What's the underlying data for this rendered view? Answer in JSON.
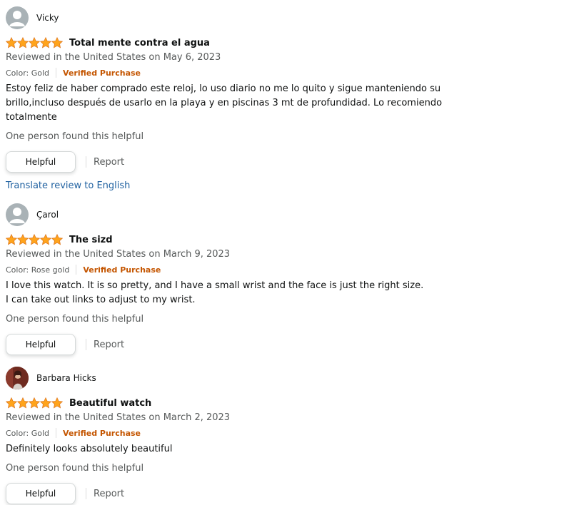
{
  "reviews": [
    {
      "profile_name": "Vicky",
      "avatar": "default-avatar-icon",
      "rating": 5,
      "title": "Total mente contra el agua",
      "date": "Reviewed in the United States on May 6, 2023",
      "variant": "Color: Gold",
      "verified": "Verified Purchase",
      "body": [
        "Estoy feliz de haber comprado este reloj, lo uso diario no me lo quito y sigue manteniendo su",
        "brillo,incluso después de usarlo en la playa y en piscinas 3 mt de profundidad. Lo recomiendo",
        "totalmente"
      ],
      "helpful_count": "One person found this helpful",
      "helpful_label": "Helpful",
      "report_label": "Report",
      "translate_label": "Translate review to English"
    },
    {
      "profile_name": "Çarol",
      "avatar": "default-avatar-icon",
      "rating": 5,
      "title": "The sizd",
      "date": "Reviewed in the United States on March 9, 2023",
      "variant": "Color: Rose gold",
      "verified": "Verified Purchase",
      "body": [
        "I love this watch. It is so pretty, and I have a small wrist and the face is just the right size.",
        "I can take out links to adjust to my wrist."
      ],
      "helpful_count": "One person found this helpful",
      "helpful_label": "Helpful",
      "report_label": "Report"
    },
    {
      "profile_name": "Barbara Hicks",
      "avatar": "photo-avatar",
      "rating": 5,
      "title": "Beautiful watch",
      "date": "Reviewed in the United States on March 2, 2023",
      "variant": "Color: Gold",
      "verified": "Verified Purchase",
      "body": [
        "Definitely looks absolutely beautiful"
      ],
      "helpful_count": "One person found this helpful",
      "helpful_label": "Helpful",
      "report_label": "Report"
    }
  ],
  "colors": {
    "star": "#ffa41c",
    "verified": "#c45500",
    "link": "#2162a1",
    "muted": "#565959"
  }
}
